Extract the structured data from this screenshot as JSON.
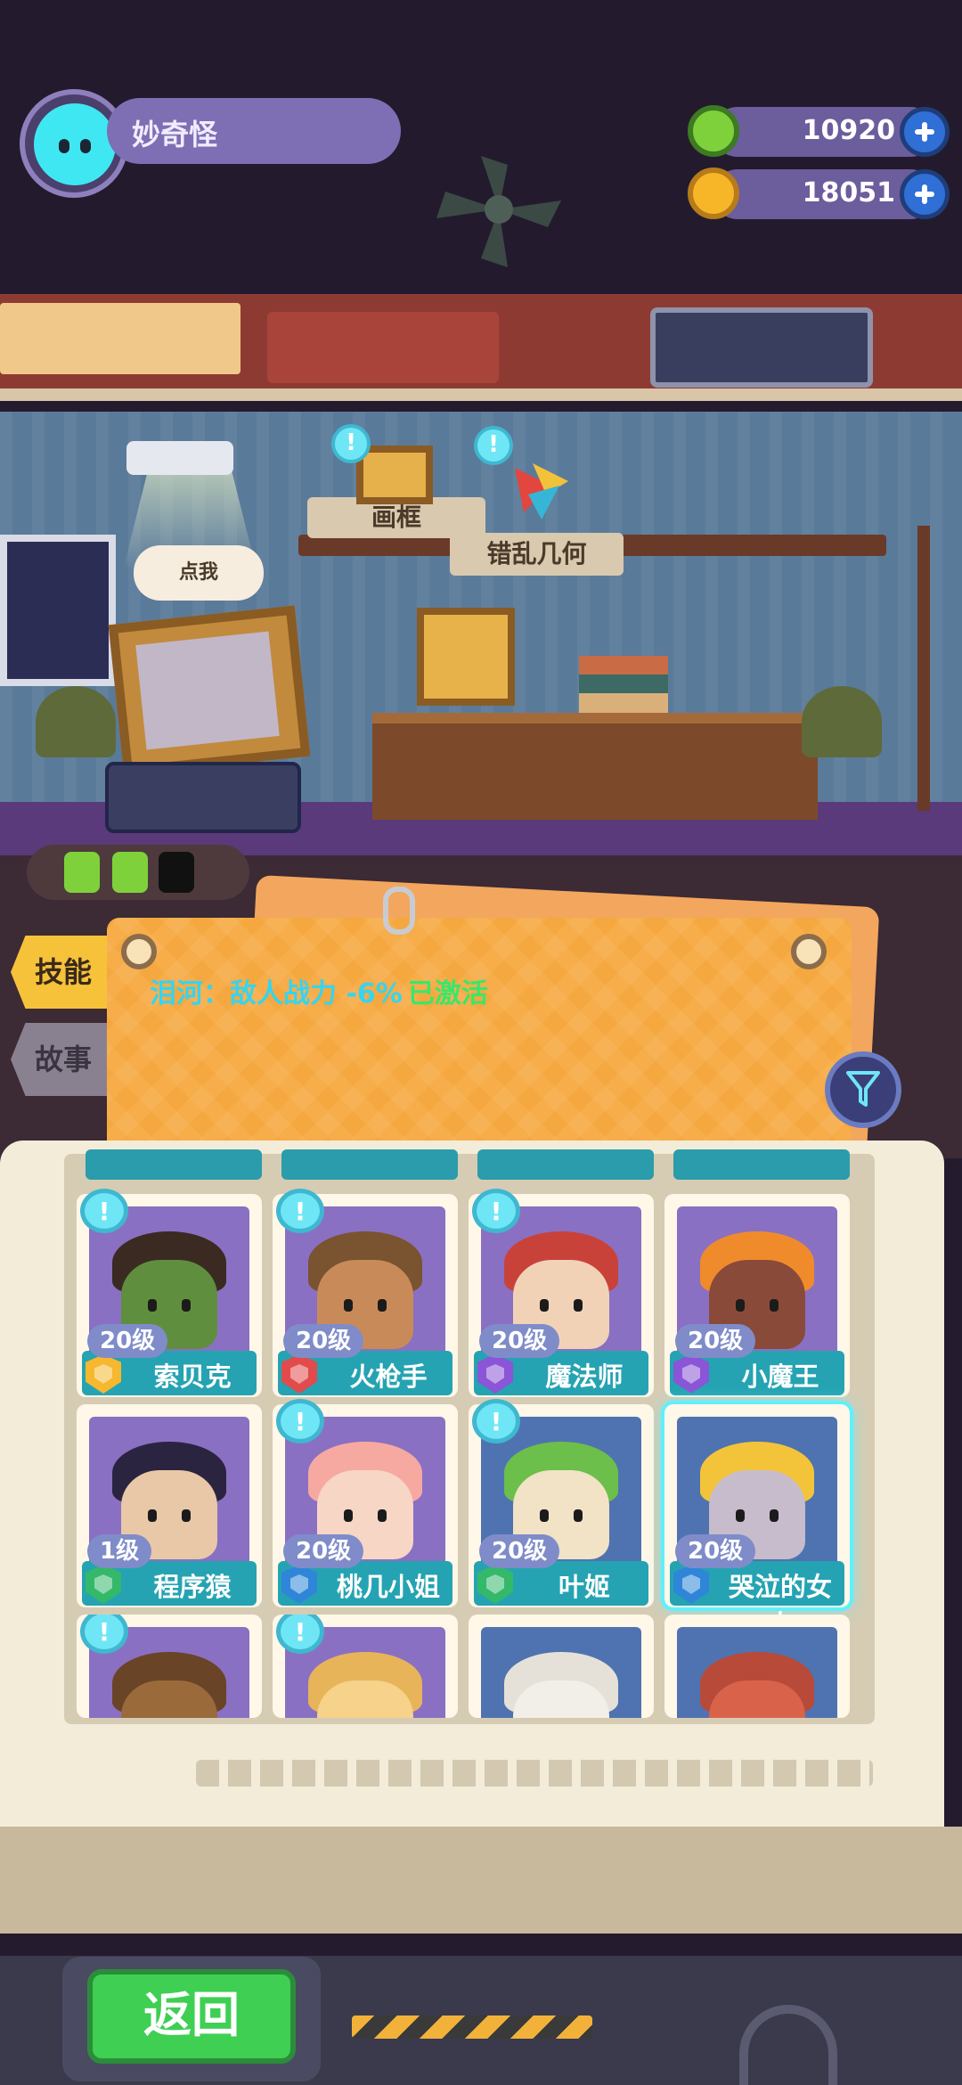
{
  "player": {
    "name": "妙奇怪"
  },
  "currencies": [
    {
      "name": "green-gem",
      "value": "10920",
      "color": "#7fd13b"
    },
    {
      "name": "gold-coin",
      "value": "18051",
      "color": "#f6b627"
    }
  ],
  "room": {
    "signs": {
      "frame": "画框",
      "puzzle": "错乱几何"
    },
    "bubble": "点我"
  },
  "tabs": {
    "skills": "技能",
    "story": "故事"
  },
  "buff": {
    "text": "泪河：敌人战力 -6%",
    "status": "已激活"
  },
  "characters": [
    {
      "level": "20级",
      "name": "索贝克",
      "badge_color": "#f5b82e",
      "notify": true,
      "face": "#5f8f3e",
      "hair": "#3b2a22"
    },
    {
      "level": "20级",
      "name": "火枪手",
      "badge_color": "#e24b4b",
      "notify": true,
      "face": "#c98a5a",
      "hair": "#7a5330"
    },
    {
      "level": "20级",
      "name": "魔法师",
      "badge_color": "#8a55d6",
      "notify": true,
      "face": "#f2d2b6",
      "hair": "#c9423a"
    },
    {
      "level": "20级",
      "name": "小魔王",
      "badge_color": "#8a55d6",
      "notify": false,
      "face": "#8a4a3a",
      "hair": "#f08b2c"
    },
    {
      "level": "1级",
      "name": "程序猿",
      "badge_color": "#34b86a",
      "notify": false,
      "face": "#e9c8a8",
      "hair": "#2b2440"
    },
    {
      "level": "20级",
      "name": "桃几小姐",
      "badge_color": "#2f86d8",
      "notify": true,
      "face": "#f7d6c6",
      "hair": "#f6a9a0"
    },
    {
      "level": "20级",
      "name": "叶姬",
      "badge_color": "#34b86a",
      "notify": true,
      "face": "#f2e2c6",
      "hair": "#6cbf4a"
    },
    {
      "level": "20级",
      "name": "哭泣的女人",
      "badge_color": "#2f86d8",
      "notify": false,
      "face": "#c7bccb",
      "hair": "#f3c43a"
    },
    {
      "notify": true,
      "face": "#9a6a3a",
      "hair": "#6a4426"
    },
    {
      "notify": true,
      "face": "#f6d28a",
      "hair": "#e8b45a"
    },
    {
      "notify": false,
      "face": "#f2efe8",
      "hair": "#e6e1d8"
    },
    {
      "notify": false,
      "face": "#d9634a",
      "hair": "#b84a3a"
    }
  ],
  "bottom": {
    "back_label": "返回"
  }
}
